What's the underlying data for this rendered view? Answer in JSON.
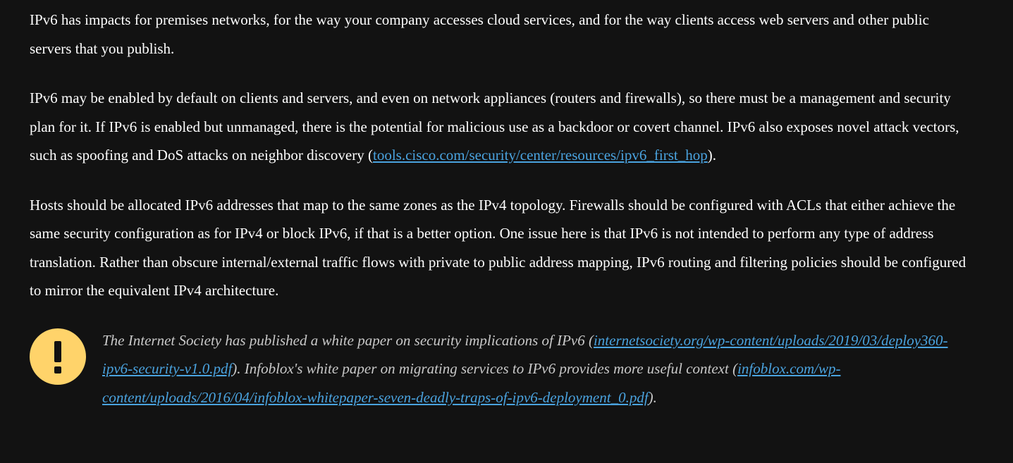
{
  "paragraphs": {
    "p1": "IPv6 has impacts for premises networks, for the way your company accesses cloud services, and for the way clients access web servers and other public servers that you publish.",
    "p2_before_link": "IPv6 may be enabled by default on clients and servers, and even on network appliances (routers and firewalls), so there must be a management and security plan for it. If IPv6 is enabled but unmanaged, there is the potential for malicious use as a backdoor or covert channel. IPv6 also exposes novel attack vectors, such as spoofing and DoS attacks on neighbor discovery (",
    "p2_link": "tools.cisco.com/security/center/resources/ipv6_first_hop",
    "p2_after_link": ").",
    "p3": "Hosts should be allocated IPv6 addresses that map to the same zones as the IPv4 topology. Firewalls should be configured with ACLs that either achieve the same security configuration as for IPv4 or block IPv6, if that is a better option. One issue here is that IPv6 is not intended to perform any type of address translation. Rather than obscure internal/external traffic flows with private to public address mapping, IPv6 routing and filtering policies should be configured to mirror the equivalent IPv4 architecture."
  },
  "note": {
    "icon": "exclamation-icon",
    "icon_color": "#ffd36a",
    "text1": "The Internet Society has published a white paper on security implications of IPv6 (",
    "link1": "internetsociety.org/wp-content/uploads/2019/03/deploy360-ipv6-security-v1.0.pdf",
    "text2": "). Infoblox's white paper on migrating services to IPv6 provides more useful context (",
    "link2": "infoblox.com/wp-content/uploads/2016/04/infoblox-whitepaper-seven-deadly-traps-of-ipv6-deployment_0.pdf",
    "text3": ")."
  },
  "colors": {
    "background": "#121212",
    "text": "#ffffff",
    "note_text": "#c9c9c9",
    "link": "#4aa3df"
  }
}
